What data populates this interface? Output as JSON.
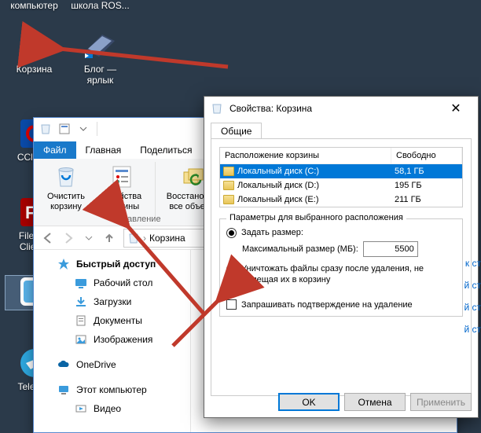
{
  "desktop": {
    "icons": [
      {
        "label": "компьютер"
      },
      {
        "label": "школа ROS..."
      },
      {
        "label": "Корзина"
      },
      {
        "label": "Блог — ярлык"
      },
      {
        "label": "CClea..."
      },
      {
        "label": "FileZi... Clien..."
      },
      {
        "label": "Telegr..."
      }
    ]
  },
  "explorer": {
    "tabs": {
      "file": "Файл",
      "home": "Главная",
      "share": "Поделиться",
      "groupLabel": "Управление",
      "groupLabel2": "Восс"
    },
    "ribbon": {
      "empty": "Очистить корзину",
      "props": "Свойства корзины",
      "restore_all": "Восстановить все объекты"
    },
    "breadcrumb": "Корзина",
    "nav": {
      "quick": "Быстрый доступ",
      "desktop": "Рабочий стол",
      "downloads": "Загрузки",
      "documents": "Документы",
      "pictures": "Изображения",
      "onedrive": "OneDrive",
      "thispc": "Этот компьютер",
      "videos": "Видео"
    }
  },
  "props": {
    "title": "Свойства: Корзина",
    "tab_general": "Общие",
    "col_location": "Расположение корзины",
    "col_free": "Свободно",
    "drives": [
      {
        "name": "Локальный диск (C:)",
        "free": "58,1 ГБ"
      },
      {
        "name": "Локальный диск (D:)",
        "free": "195 ГБ"
      },
      {
        "name": "Локальный диск (E:)",
        "free": "211 ГБ"
      }
    ],
    "group_title": "Параметры для выбранного расположения",
    "opt_setsize": "Задать размер:",
    "opt_maxsize": "Максимальный размер (МБ):",
    "size_value": "5500",
    "opt_destroy": "Уничтожать файлы сразу после удаления, не помещая их в корзину",
    "opt_confirm": "Запрашивать подтверждение на удаление",
    "btn_ok": "OK",
    "btn_cancel": "Отмена",
    "btn_apply": "Применить"
  },
  "peek": [
    "к ст",
    "й ст",
    "й ст",
    "й ст"
  ],
  "selected_icon_index": 4
}
